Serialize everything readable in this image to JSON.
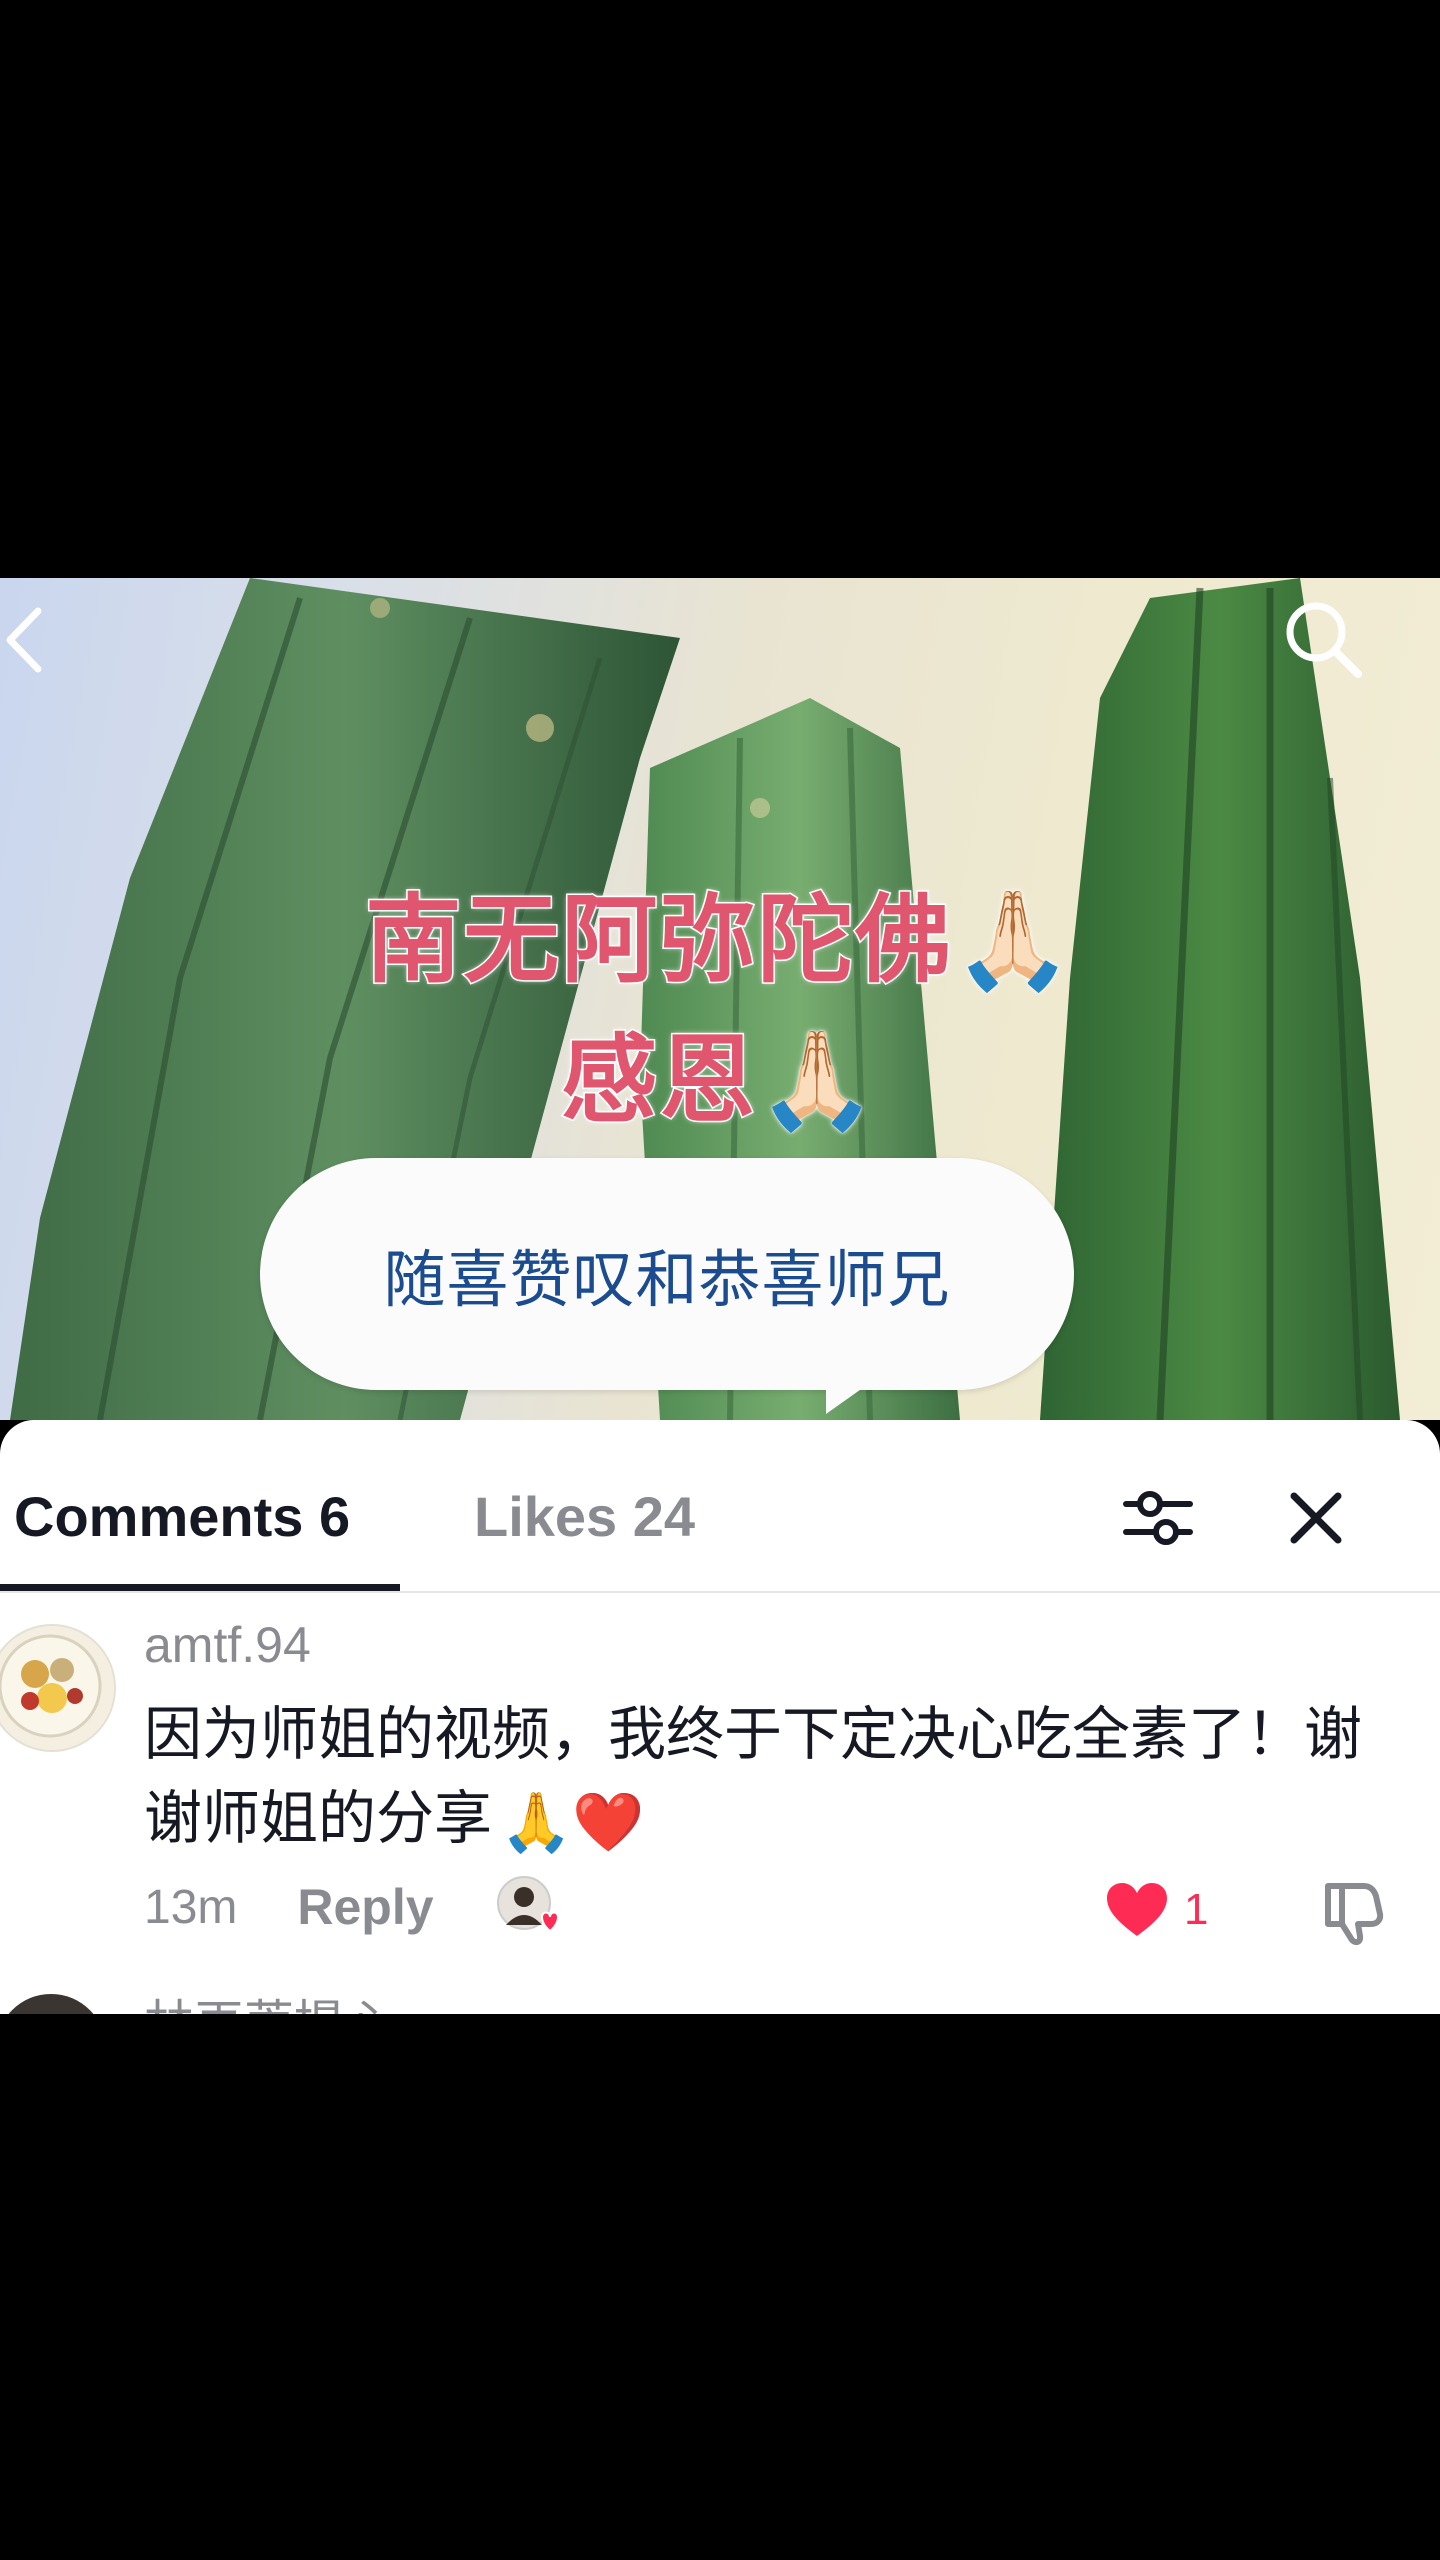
{
  "video": {
    "overlay_line_1": "南无阿弥陀佛🙏🏻",
    "overlay_line_2": "感恩🙏🏻",
    "bubble_text": "随喜赞叹和恭喜师兄"
  },
  "nav": {
    "back_icon": "chevron-left-icon",
    "search_icon": "search-icon"
  },
  "comments_panel": {
    "tab_comments": "Comments 6",
    "tab_likes": "Likes 24",
    "filter_icon": "sliders-icon",
    "close_icon": "close-icon",
    "comments": [
      {
        "username": "amtf.94",
        "text": "因为师姐的视频，我终于下定决心吃全素了！谢谢师姐的分享",
        "emoji": "🙏❤️",
        "time": "13m",
        "reply_label": "Reply",
        "likes": "1"
      },
      {
        "username": "林再菩提心"
      }
    ]
  },
  "colors": {
    "overlay_pink": "#e0566e",
    "bubble_text_blue": "#1b4c8f",
    "like_red": "#fe2c55",
    "muted_gray": "#8a8b91"
  }
}
